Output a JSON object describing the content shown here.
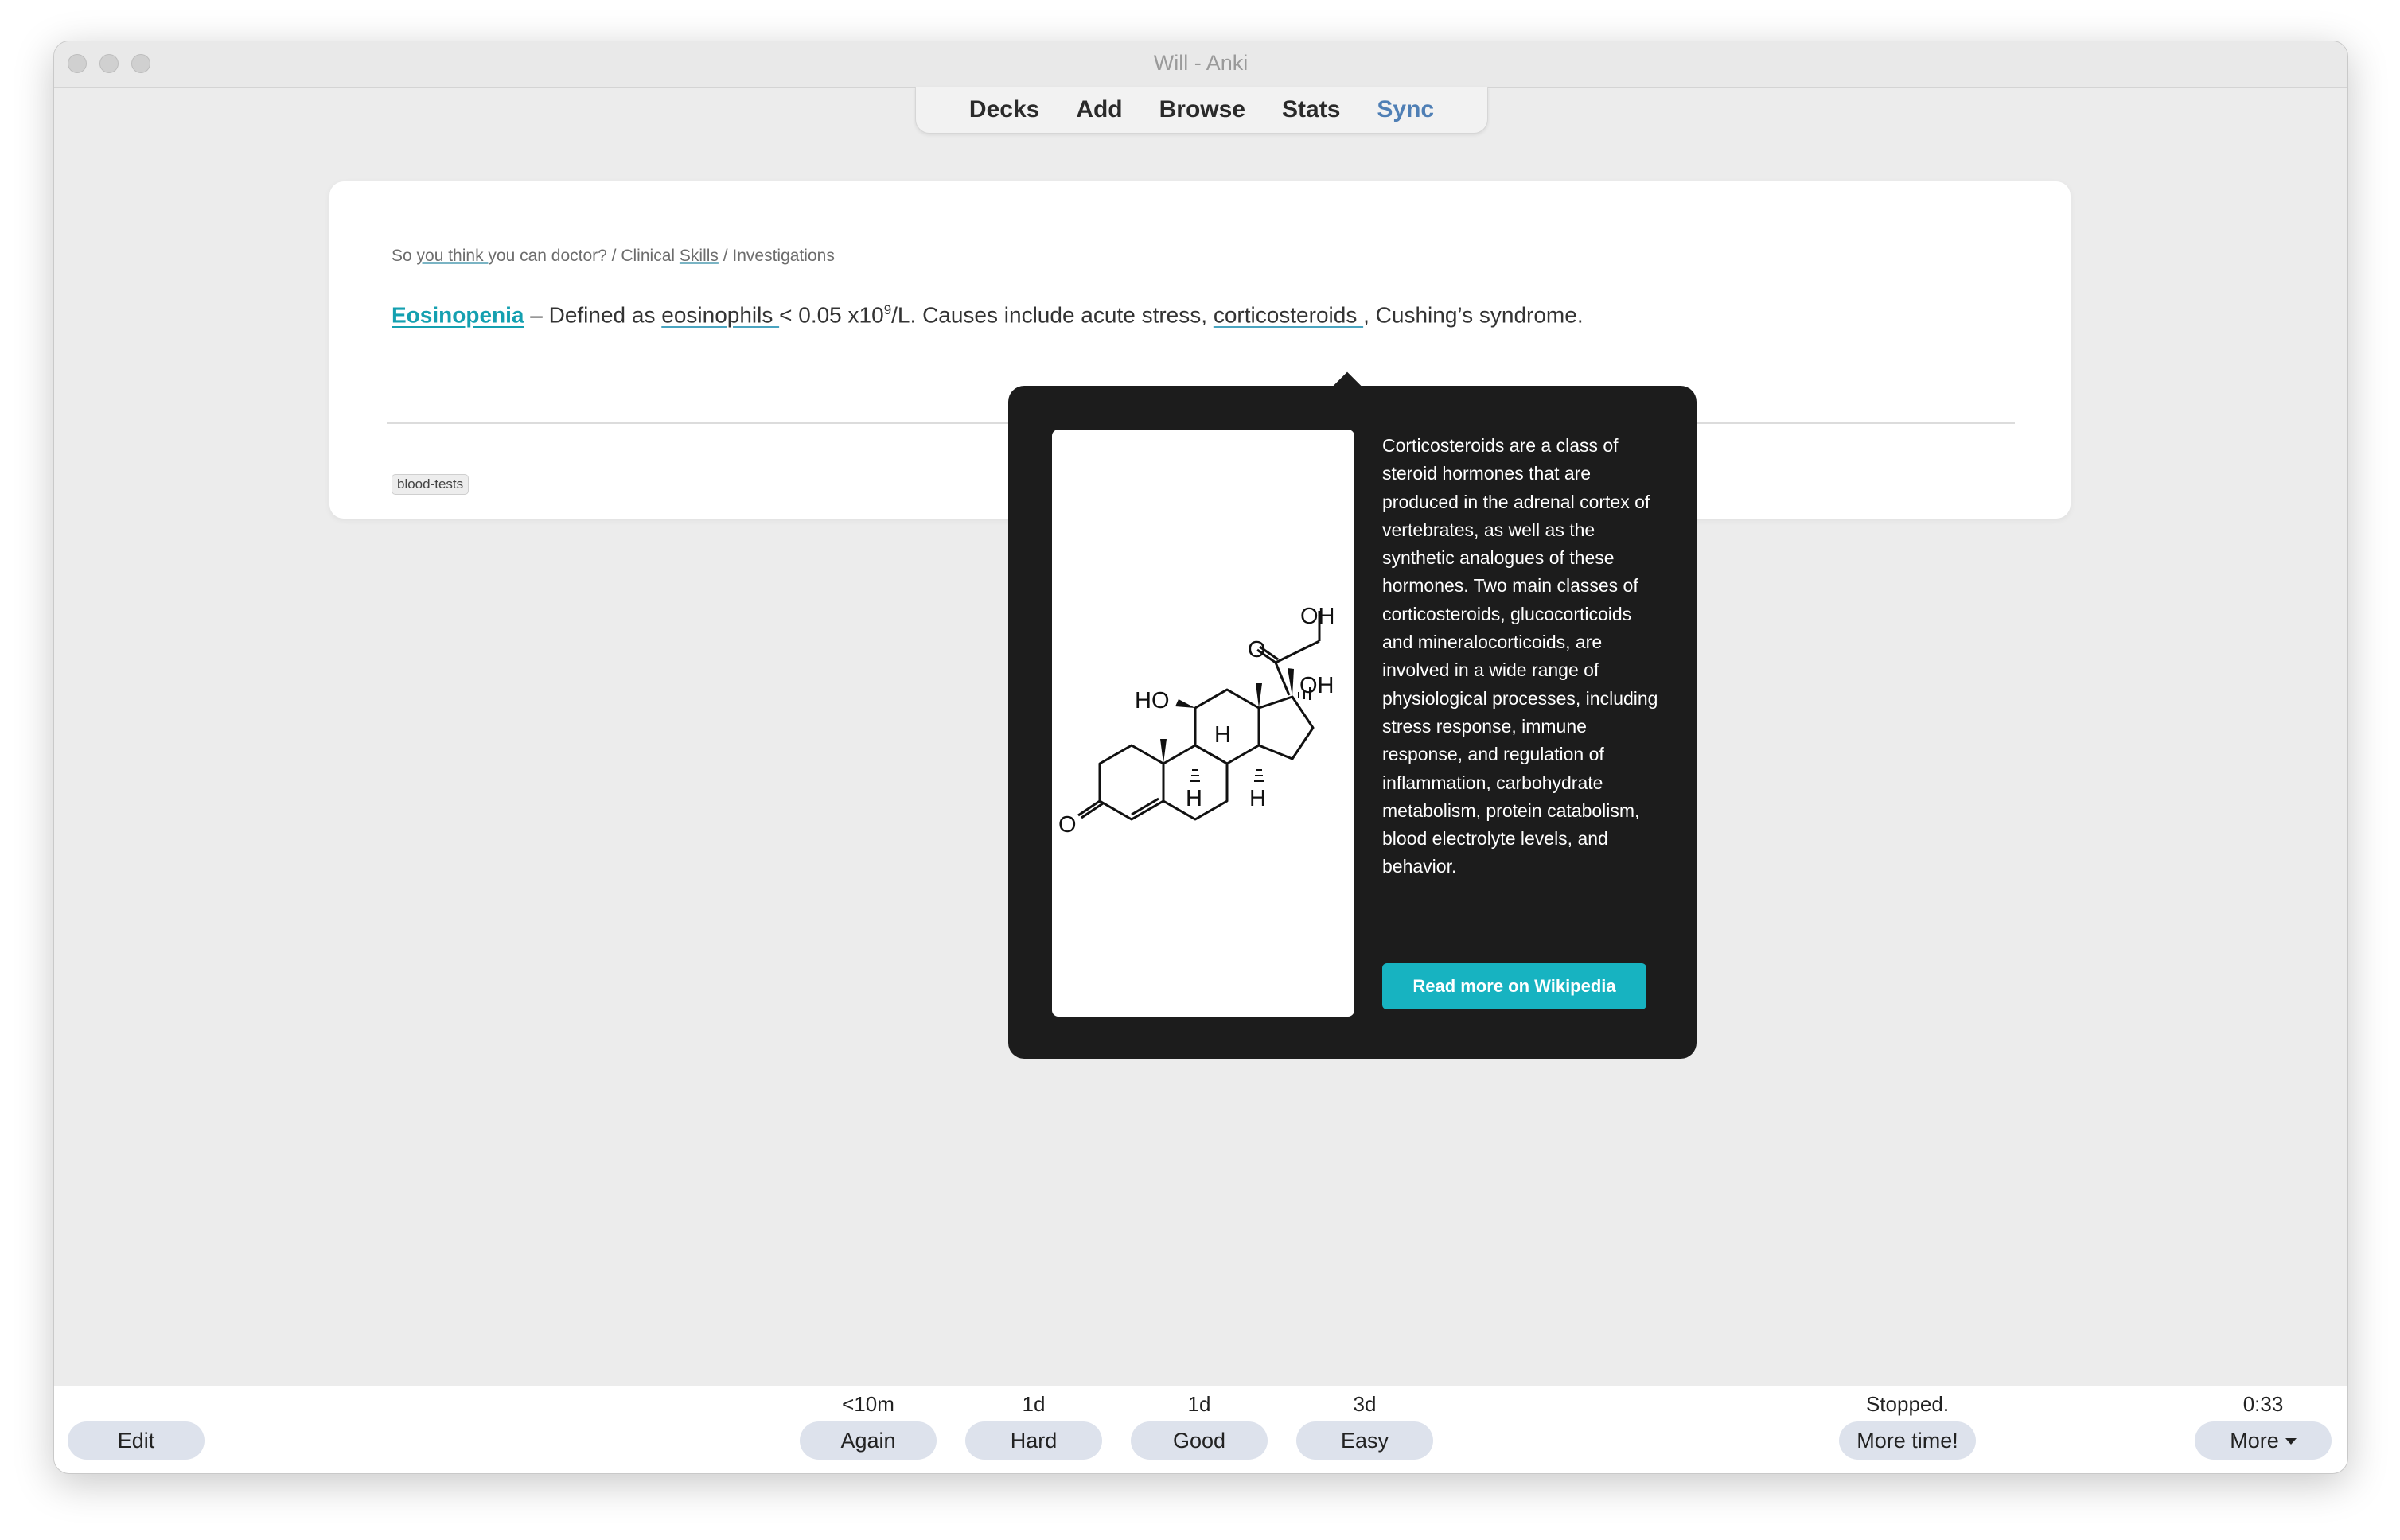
{
  "window": {
    "title": "Will - Anki"
  },
  "nav": {
    "decks": "Decks",
    "add": "Add",
    "browse": "Browse",
    "stats": "Stats",
    "sync": "Sync"
  },
  "card": {
    "breadcrumb": {
      "p1": "So ",
      "p2": "you think ",
      "p3": "you can doctor? / Clinical ",
      "p4": "Skills",
      "p5": " / Investigations"
    },
    "sentence": {
      "term": "Eosinopenia",
      "t1": " – Defined as ",
      "link1": "eosinophils ",
      "t2": "< 0.05 x10",
      "sup": "9",
      "t3": "/L. Causes include acute stress, ",
      "link2": "corticosteroids ",
      "t4": ", Cushing’s syndrome."
    },
    "tag": "blood-tests"
  },
  "popover": {
    "description": "Corticosteroids are a class of steroid hormones that are produced in the adrenal cortex of vertebrates, as well as the synthetic analogues of these hormones. Two main classes of corticosteroids, glucocorticoids and mineralocorticoids, are involved in a wide range of physiological processes, including stress response, immune response, and regulation of inflammation, carbohydrate metabolism, protein catabolism, blood electrolyte levels, and behavior.",
    "button": "Read more on Wikipedia",
    "molecule_labels": {
      "oh_top": "OH",
      "oh_side": "OH",
      "ho": "HO",
      "o_ketone": "O",
      "o_ring": "O",
      "h1": "H",
      "h2": "H",
      "h3": "H"
    }
  },
  "bottom": {
    "edit": "Edit",
    "again": {
      "due": "<10m",
      "label": "Again"
    },
    "hard": {
      "due": "1d",
      "label": "Hard"
    },
    "good": {
      "due": "1d",
      "label": "Good"
    },
    "easy": {
      "due": "3d",
      "label": "Easy"
    },
    "timer_status": "Stopped.",
    "more_time": "More time!",
    "elapsed": "0:33",
    "more": "More"
  }
}
